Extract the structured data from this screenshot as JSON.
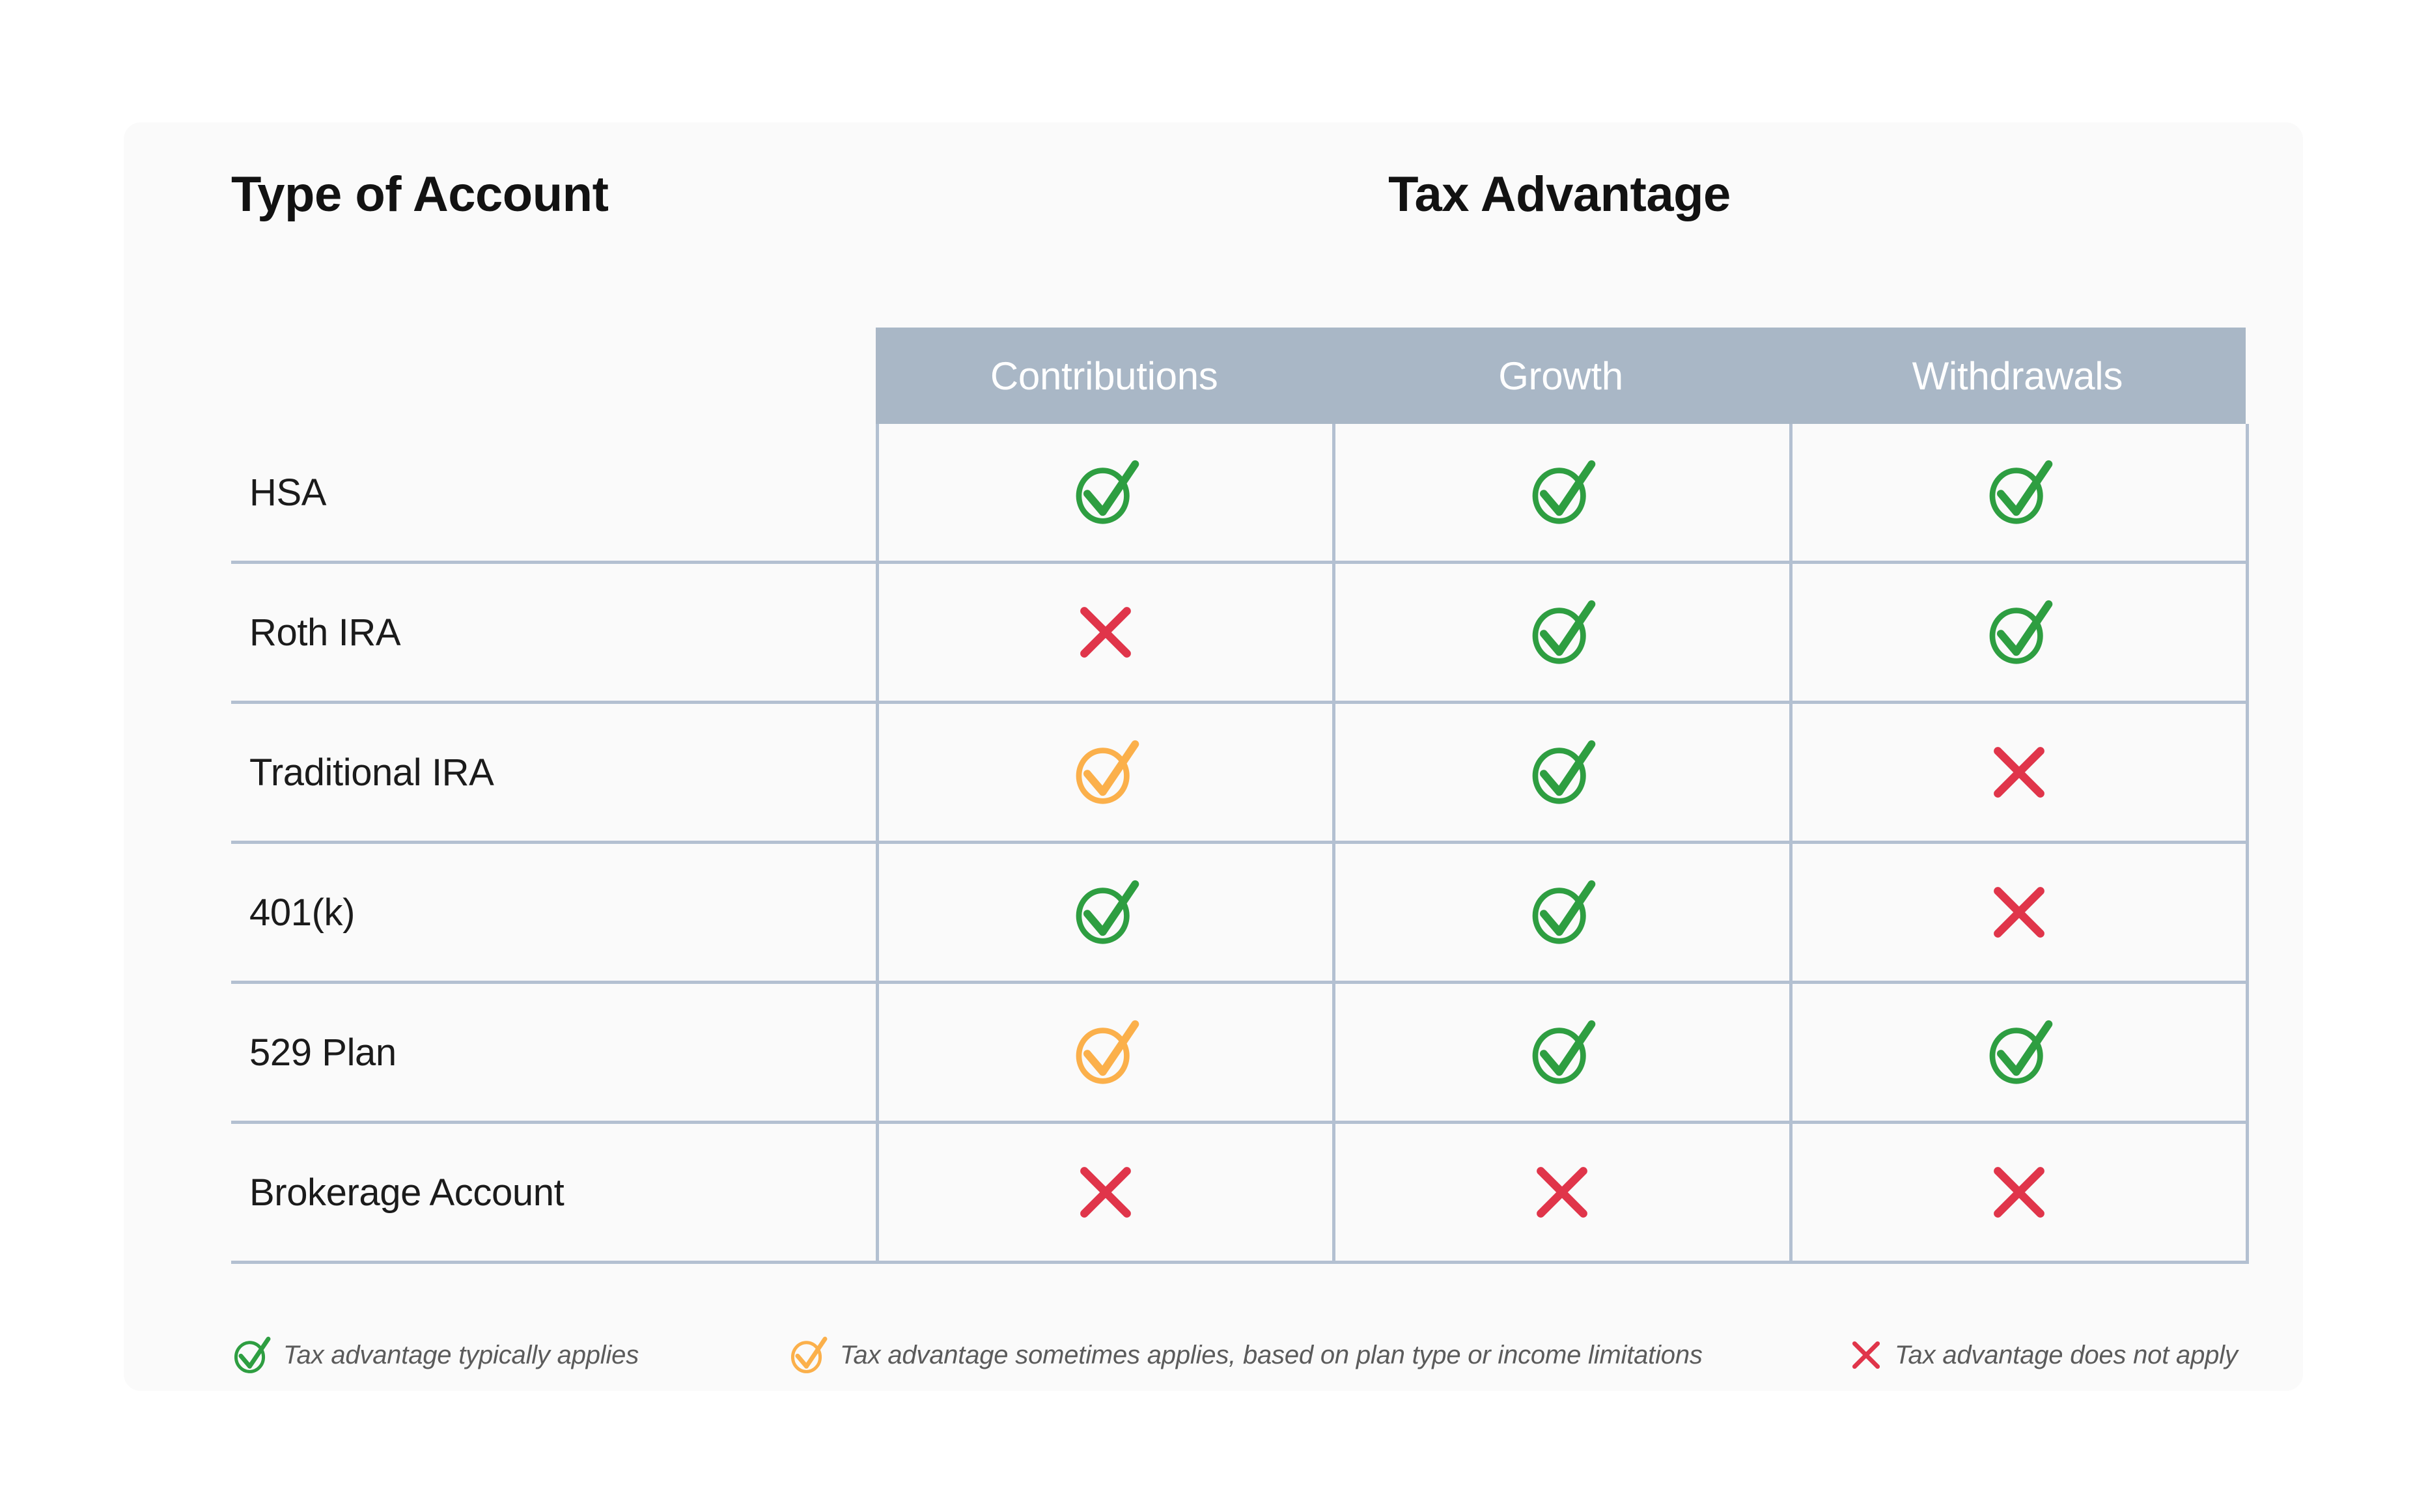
{
  "page": {
    "card_background": "#fafafa",
    "page_background": "#ffffff"
  },
  "titles": {
    "left": "Type of Account",
    "right": "Tax Advantage"
  },
  "colors": {
    "header_band": "#a9b7c6",
    "grid_line": "#b3c0d1",
    "check_green": "#2e9e41",
    "check_orange": "#fbb04b",
    "cross_red": "#e0354a",
    "title_text": "#121212",
    "row_text": "#1b1b1b",
    "legend_text": "#5b5b5b",
    "header_text": "#ffffff"
  },
  "table": {
    "row_header_label": "",
    "columns": [
      "Contributions",
      "Growth",
      "Withdrawals"
    ],
    "rows": [
      {
        "label": "HSA",
        "values": [
          "yes",
          "yes",
          "yes"
        ]
      },
      {
        "label": "Roth IRA",
        "values": [
          "no",
          "yes",
          "yes"
        ]
      },
      {
        "label": "Traditional IRA",
        "values": [
          "maybe",
          "yes",
          "no"
        ]
      },
      {
        "label": "401(k)",
        "values": [
          "yes",
          "yes",
          "no"
        ]
      },
      {
        "label": "529 Plan",
        "values": [
          "maybe",
          "yes",
          "yes"
        ]
      },
      {
        "label": "Brokerage Account",
        "values": [
          "no",
          "no",
          "no"
        ]
      }
    ]
  },
  "legend": [
    {
      "icon": "check-circle-green-icon",
      "status": "yes",
      "text": "Tax advantage typically applies"
    },
    {
      "icon": "check-circle-orange-icon",
      "status": "maybe",
      "text": "Tax advantage sometimes applies, based on plan type or income limitations"
    },
    {
      "icon": "cross-red-icon",
      "status": "no",
      "text": "Tax advantage does not apply"
    }
  ]
}
